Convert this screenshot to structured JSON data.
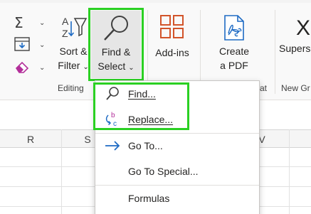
{
  "ribbon": {
    "editing_group": {
      "group_label": "Editing",
      "autosum_icon": "sigma-icon",
      "fill_icon": "fill-down-icon",
      "clear_icon": "eraser-icon",
      "sort_filter": {
        "line1": "Sort &",
        "line2": "Filter",
        "icon": "sort-filter-icon"
      },
      "find_select": {
        "line1": "Find &",
        "line2": "Select",
        "icon": "magnifier-icon"
      }
    },
    "addins_group": {
      "label": "Add-ins",
      "icon": "addins-grid-icon"
    },
    "pdf_group": {
      "line1": "Create",
      "line2": "a PDF",
      "partial_group_label": "at",
      "icon": "pdf-link-icon"
    },
    "superscript": {
      "partial_label": "Supersc",
      "partial_group_label": "New Gr"
    }
  },
  "sheet": {
    "columns": [
      "R",
      "S",
      "V"
    ]
  },
  "menu": {
    "items": [
      {
        "label": "Find...",
        "accel": "F",
        "icon": "magnifier-icon"
      },
      {
        "label": "Replace...",
        "accel": "R",
        "icon": "replace-icon"
      },
      {
        "label": "Go To...",
        "accel": "G",
        "icon": "arrow-right-icon"
      },
      {
        "label": "Go To Special...",
        "accel": "S",
        "icon": ""
      },
      {
        "label": "Formulas",
        "accel": "u",
        "icon": ""
      }
    ]
  },
  "colors": {
    "highlight": "#2bd023",
    "accent_blue": "#1e6bc4",
    "addins_orange": "#d2542a",
    "clear_purple": "#b32f9a"
  }
}
